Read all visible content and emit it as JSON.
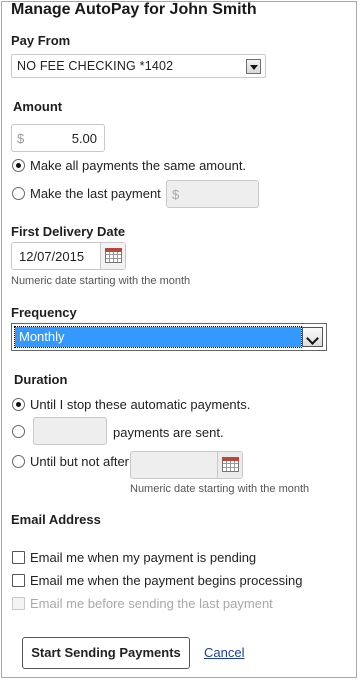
{
  "page": {
    "title": "Manage AutoPay for John Smith"
  },
  "pay_from": {
    "label": "Pay From",
    "selected": "NO FEE CHECKING *1402"
  },
  "amount": {
    "label": "Amount",
    "currency_symbol": "$",
    "value": "5.00",
    "options": [
      {
        "label": "Make all payments the same amount.",
        "checked": true
      },
      {
        "label": "Make the last payment",
        "checked": false
      }
    ],
    "last_payment_currency": "$",
    "last_payment_value": ""
  },
  "first_delivery": {
    "label": "First Delivery Date",
    "value": "12/07/2015",
    "hint": "Numeric date starting with the month"
  },
  "frequency": {
    "label": "Frequency",
    "selected": "Monthly"
  },
  "duration": {
    "label": "Duration",
    "opt_until_stop": "Until I stop these automatic payments.",
    "opt_count_suffix": "payments are sent.",
    "count_value": "",
    "opt_until_date": "Until but not after",
    "until_date_value": "",
    "hint": "Numeric date starting with the month"
  },
  "email": {
    "label": "Email Address",
    "opt_pending": "Email me when my payment is pending",
    "opt_processing": "Email me when the payment begins processing",
    "opt_last": "Email me before sending the last payment"
  },
  "actions": {
    "submit": "Start Sending Payments",
    "cancel": "Cancel"
  },
  "colors": {
    "link": "#1a3fa8",
    "selection": "#3399ff",
    "calendar_header": "#b54a3c"
  },
  "icons": {
    "calendar": "calendar-icon",
    "dropdown": "chevron-down-icon"
  }
}
